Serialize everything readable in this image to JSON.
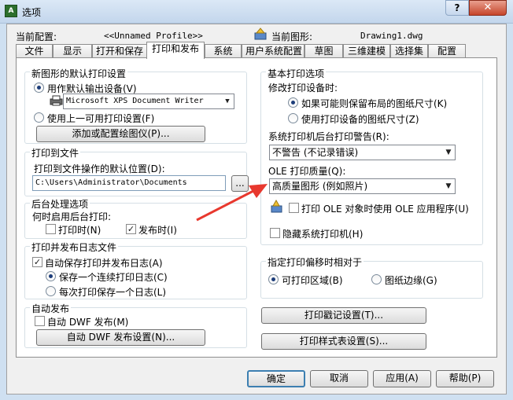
{
  "window": {
    "title": "选项",
    "app_icon_text": "A",
    "help_label": "?",
    "close_label": "✕"
  },
  "header": {
    "current_config_label": "当前配置:",
    "current_config_value": "<<Unnamed Profile>>",
    "current_drawing_label": "当前图形:",
    "current_drawing_value": "Drawing1.dwg"
  },
  "tabs": [
    "文件",
    "显示",
    "打开和保存",
    "打印和发布",
    "系统",
    "用户系统配置",
    "草图",
    "三维建模",
    "选择集",
    "配置"
  ],
  "active_tab": "打印和发布",
  "new_drawing_group": {
    "title": "新图形的默认打印设置",
    "use_default_device": "用作默认输出设备(V)",
    "device_value": "Microsoft XPS Document Writer",
    "use_last_settings": "使用上一可用打印设置(F)",
    "add_plotter_button": "添加或配置绘图仪(P)..."
  },
  "plot_to_file_group": {
    "title": "打印到文件",
    "default_location_label": "打印到文件操作的默认位置(D):",
    "location_value": "C:\\Users\\Administrator\\Documents",
    "browse_button": "..."
  },
  "background_group": {
    "title": "后台处理选项",
    "enable_label": "何时启用后台打印:",
    "when_plotting": "打印时(N)",
    "when_publishing": "发布时(I)"
  },
  "log_group": {
    "title": "打印并发布日志文件",
    "auto_save": "自动保存打印并发布日志(A)",
    "continuous_log": "保存一个连续打印日志(C)",
    "per_plot_log": "每次打印保存一个日志(L)"
  },
  "auto_publish_group": {
    "title": "自动发布",
    "auto_dwf": "自动 DWF 发布(M)",
    "settings_button": "自动 DWF 发布设置(N)..."
  },
  "general_group": {
    "title": "基本打印选项",
    "modify_label": "修改打印设备时:",
    "keep_layout": "如果可能则保留布局的图纸尺寸(K)",
    "use_device_size": "使用打印设备的图纸尺寸(Z)",
    "spooler_label": "系统打印机后台打印警告(R):",
    "spooler_value": "不警告 (不记录错误)",
    "ole_quality_label": "OLE 打印质量(Q):",
    "ole_quality_value": "高质量图形 (例如照片)",
    "ole_app": "打印 OLE 对象时使用 OLE 应用程序(U)",
    "hide_printers": "隐藏系统打印机(H)"
  },
  "offset_group": {
    "title": "指定打印偏移时相对于",
    "printable_area": "可打印区域(B)",
    "paper_edge": "图纸边缘(G)"
  },
  "buttons": {
    "plot_stamp": "打印戳记设置(T)...",
    "plot_style_table": "打印样式表设置(S)...",
    "ok": "确定",
    "cancel": "取消",
    "apply": "应用(A)",
    "help": "帮助(P)"
  },
  "colors": {
    "annotation_arrow": "#e8382e",
    "accent": "#1d3d7a"
  }
}
